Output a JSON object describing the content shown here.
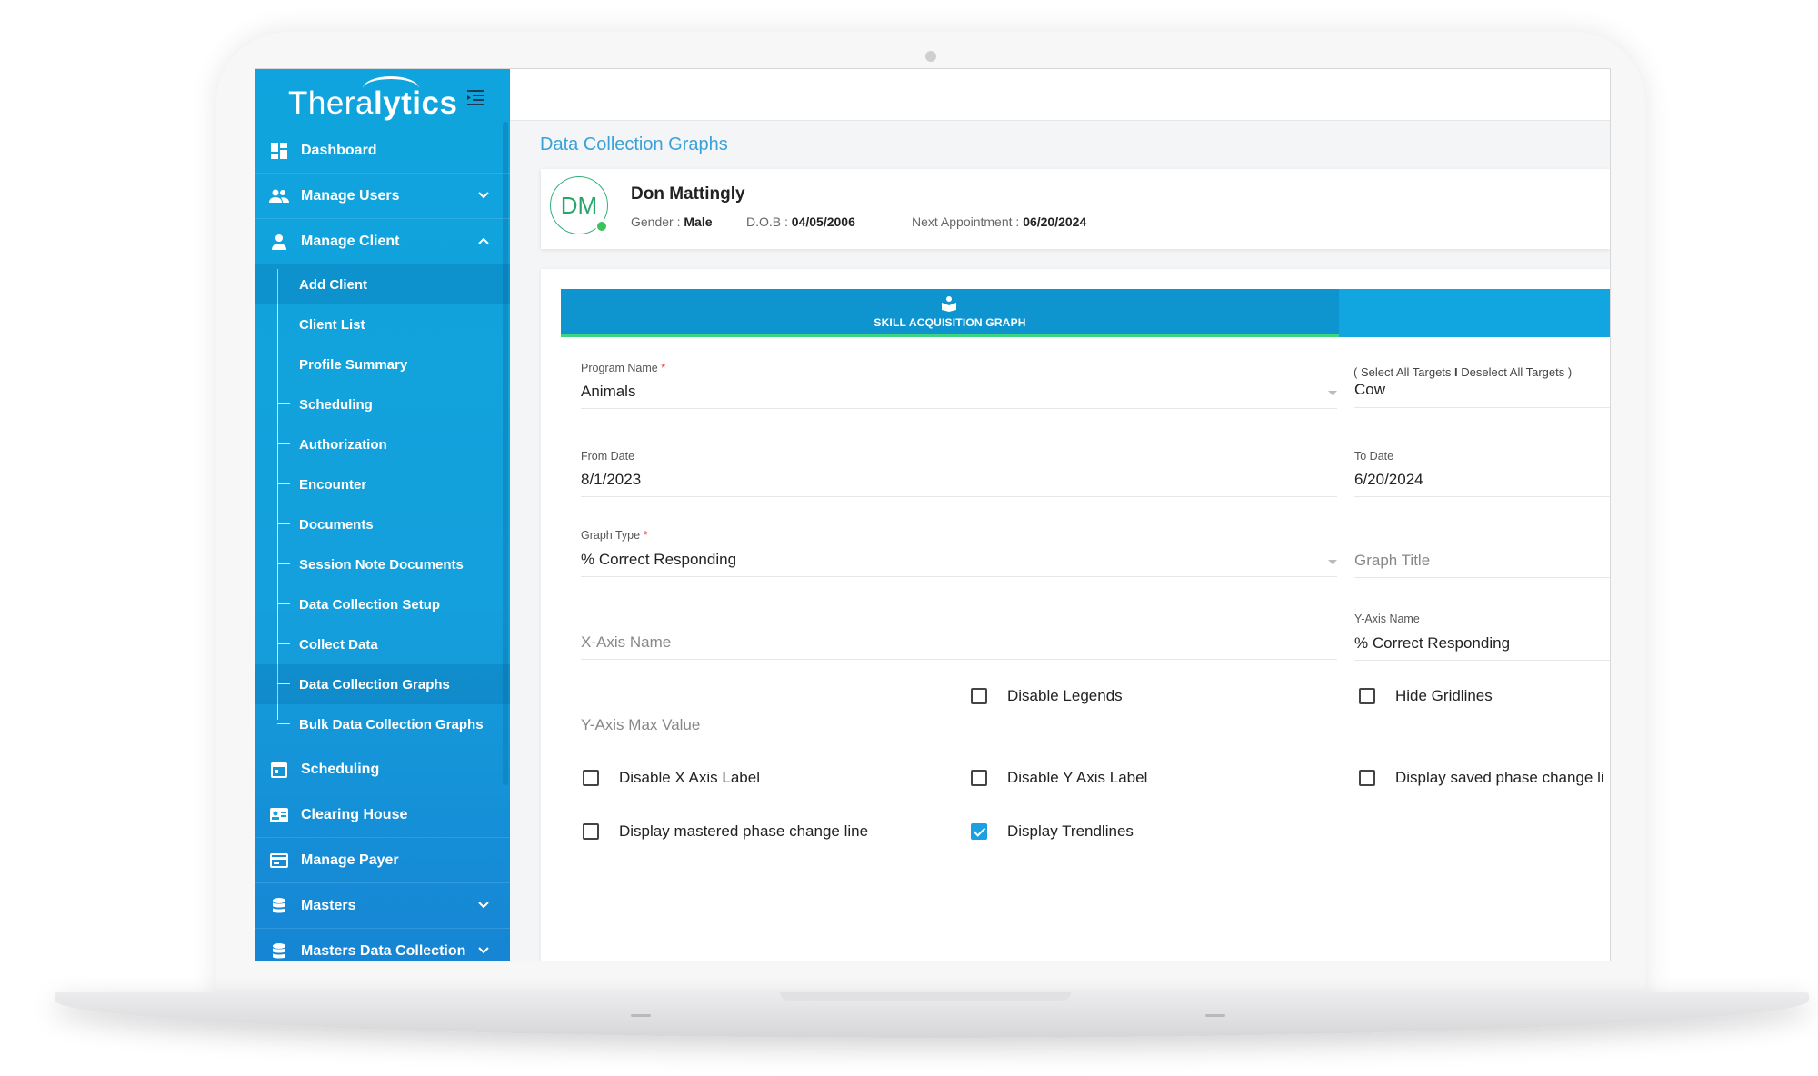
{
  "brand": {
    "logo_light": "Thera",
    "logo_bold": "lytics",
    "accent": "#12a6e0",
    "active_tab_underline": "#3fd47f"
  },
  "sidebar": {
    "items": [
      {
        "label": "Dashboard",
        "icon": "dashboard-icon"
      },
      {
        "label": "Manage Users",
        "icon": "users-icon",
        "chevron": "down"
      },
      {
        "label": "Manage Client",
        "icon": "person-icon",
        "chevron": "up"
      }
    ],
    "sub_items": [
      "Add Client",
      "Client List",
      "Profile Summary",
      "Scheduling",
      "Authorization",
      "Encounter",
      "Documents",
      "Session Note Documents",
      "Data Collection Setup",
      "Collect Data",
      "Data Collection Graphs",
      "Bulk Data Collection Graphs"
    ],
    "items_after": [
      {
        "label": "Scheduling",
        "icon": "calendar-icon"
      },
      {
        "label": "Clearing House",
        "icon": "id-card-icon"
      },
      {
        "label": "Manage Payer",
        "icon": "card-icon"
      },
      {
        "label": "Masters",
        "icon": "database-icon",
        "chevron": "down"
      },
      {
        "label": "Masters Data Collection",
        "icon": "database-icon",
        "chevron": "down"
      }
    ]
  },
  "page": {
    "title": "Data Collection Graphs"
  },
  "client": {
    "initials": "DM",
    "name": "Don Mattingly",
    "gender_label": "Gender : ",
    "gender": "Male",
    "dob_label": "D.O.B : ",
    "dob": "04/05/2006",
    "next_label": "Next Appointment : ",
    "next": "06/20/2024"
  },
  "tabs": {
    "active": "SKILL ACQUISITION GRAPH"
  },
  "form": {
    "program_label": "Program Name",
    "required_mark": "*",
    "program_value": "Animals",
    "select_all": "( Select All Targets",
    "separator": "I",
    "deselect_all": "Deselect All Targets )",
    "target_value": "Cow",
    "from_label": "From Date",
    "from_value": "8/1/2023",
    "to_label": "To Date",
    "to_value": "6/20/2024",
    "graph_type_label": "Graph Type",
    "graph_type_value": "% Correct Responding",
    "graph_title_placeholder": "Graph Title",
    "x_axis_placeholder": "X-Axis Name",
    "y_axis_label": "Y-Axis Name",
    "y_axis_value": "% Correct Responding",
    "y_max_placeholder": "Y-Axis Max Value"
  },
  "checkboxes": {
    "disable_legends": {
      "label": "Disable Legends",
      "checked": false
    },
    "hide_gridlines": {
      "label": "Hide Gridlines",
      "checked": false
    },
    "disable_x_label": {
      "label": "Disable X Axis Label",
      "checked": false
    },
    "disable_y_label": {
      "label": "Disable Y Axis Label",
      "checked": false
    },
    "display_saved_phase": {
      "label": "Display saved phase change li",
      "checked": false
    },
    "display_mastered_phase": {
      "label": "Display mastered phase change line",
      "checked": false
    },
    "display_trendlines": {
      "label": "Display Trendlines",
      "checked": true
    }
  }
}
